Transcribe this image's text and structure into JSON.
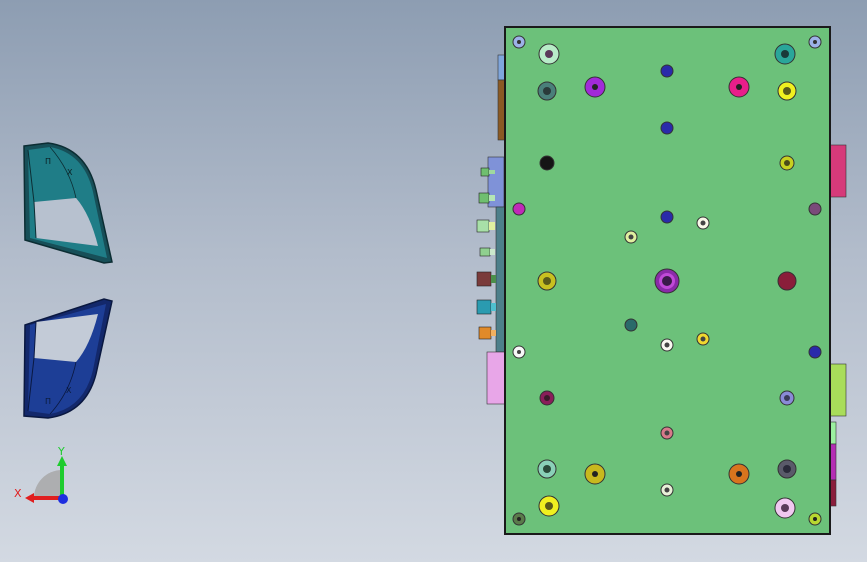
{
  "triad": {
    "x_label": "X",
    "y_label": "Y"
  },
  "part_marks": {
    "upper": [
      "П",
      "Х"
    ],
    "lower": [
      "П",
      "Х"
    ]
  },
  "colors": {
    "plate": "#6cc17a",
    "background_top": "#8d9db2",
    "background_bottom": "#d3d9e2",
    "upper_part": "#1a6f78",
    "lower_part": "#1b3a8a",
    "axis_x": "#e01e1e",
    "axis_y": "#1ecc2e",
    "axis_z": "#1e2ee0"
  },
  "icons": [
    "coordinate-triad-icon"
  ]
}
